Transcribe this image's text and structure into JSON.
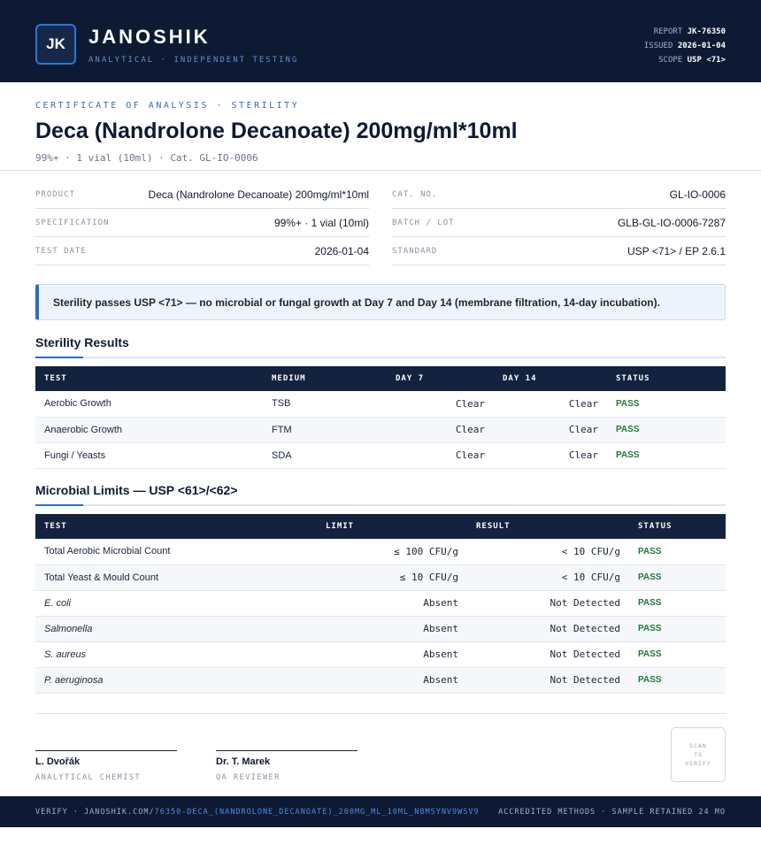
{
  "header": {
    "logo_initials": "JK",
    "brand_name": "JANOSHIK",
    "tagline": "ANALYTICAL · INDEPENDENT TESTING",
    "meta": [
      {
        "label": "REPORT",
        "value": "JK-76350"
      },
      {
        "label": "ISSUED",
        "value": "2026-01-04"
      },
      {
        "label": "SCOPE",
        "value": "USP <71>"
      }
    ]
  },
  "doc": {
    "kicker": "CERTIFICATE OF ANALYSIS · STERILITY",
    "title": "Deca (Nandrolone Decanoate) 200mg/ml*10ml",
    "subtitle": "99%+ · 1 vial (10ml)  ·  Cat. GL-IO-0006"
  },
  "info_left": [
    {
      "label": "PRODUCT",
      "value": "Deca (Nandrolone Decanoate) 200mg/ml*10ml"
    },
    {
      "label": "SPECIFICATION",
      "value": "99%+ · 1 vial (10ml)"
    },
    {
      "label": "TEST DATE",
      "value": "2026-01-04"
    }
  ],
  "info_right": [
    {
      "label": "CAT. NO.",
      "value": "GL-IO-0006"
    },
    {
      "label": "BATCH / LOT",
      "value": "GLB-GL-IO-0006-7287"
    },
    {
      "label": "STANDARD",
      "value": "USP <71> / EP 2.6.1"
    }
  ],
  "notice": "Sterility passes USP <71> — no microbial or fungal growth at Day 7 and Day 14 (membrane filtration, 14-day incubation).",
  "sterility": {
    "title": "Sterility Results",
    "headers": [
      "TEST",
      "MEDIUM",
      "DAY 7",
      "DAY 14",
      "STATUS"
    ],
    "rows": [
      {
        "test": "Aerobic Growth",
        "medium": "TSB",
        "day7": "Clear",
        "day14": "Clear",
        "status": "PASS"
      },
      {
        "test": "Anaerobic Growth",
        "medium": "FTM",
        "day7": "Clear",
        "day14": "Clear",
        "status": "PASS"
      },
      {
        "test": "Fungi / Yeasts",
        "medium": "SDA",
        "day7": "Clear",
        "day14": "Clear",
        "status": "PASS"
      }
    ]
  },
  "microbial": {
    "title": "Microbial Limits — USP <61>/<62>",
    "headers": [
      "TEST",
      "LIMIT",
      "RESULT",
      "STATUS"
    ],
    "rows": [
      {
        "test": "Total Aerobic Microbial Count",
        "limit": "≤ 100 CFU/g",
        "result": "< 10 CFU/g",
        "status": "PASS"
      },
      {
        "test": "Total Yeast & Mould Count",
        "limit": "≤ 10 CFU/g",
        "result": "< 10 CFU/g",
        "status": "PASS"
      },
      {
        "test": "E. coli",
        "limit": "Absent",
        "result": "Not Detected",
        "status": "PASS"
      },
      {
        "test": "Salmonella",
        "limit": "Absent",
        "result": "Not Detected",
        "status": "PASS"
      },
      {
        "test": "S. aureus",
        "limit": "Absent",
        "result": "Not Detected",
        "status": "PASS"
      },
      {
        "test": "P. aeruginosa",
        "limit": "Absent",
        "result": "Not Detected",
        "status": "PASS"
      }
    ]
  },
  "signatures": [
    {
      "name": "L. Dvořák",
      "role": "ANALYTICAL CHEMIST"
    },
    {
      "name": "Dr. T. Marek",
      "role": "QA REVIEWER"
    }
  ],
  "qr": {
    "line1": "SCAN",
    "line2": "TO",
    "line3": "VERIFY"
  },
  "footer": {
    "verify_prefix": "VERIFY · JANOSHIK.COM/",
    "verify_path": "76350-DECA_(NANDROLONE_DECANOATE)_200MG_ML_10ML_N8MSYNV9WSV9",
    "right": "ACCREDITED METHODS · SAMPLE RETAINED 24 MO"
  },
  "colors": {
    "navy": "#0e1a33",
    "accent": "#2c6cc6",
    "pass": "#1f7a3a"
  }
}
